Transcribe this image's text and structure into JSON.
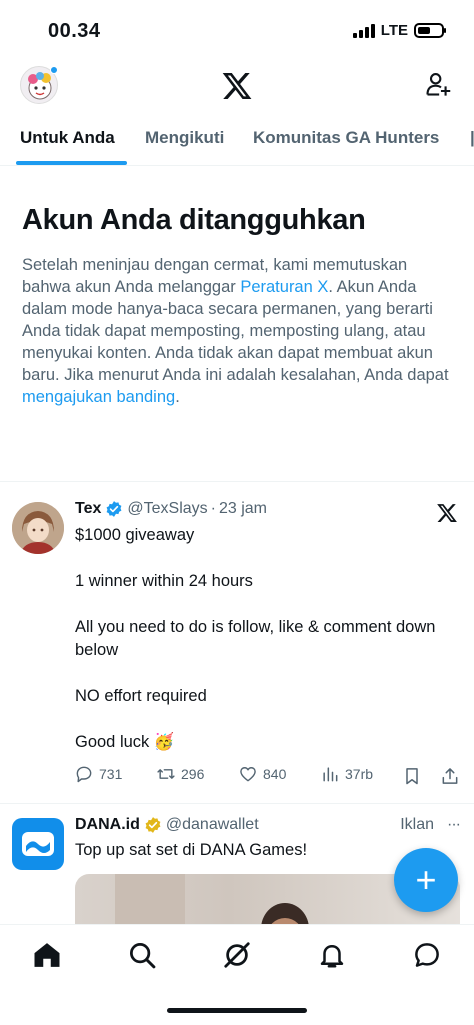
{
  "status_bar": {
    "time": "00.34",
    "network": "LTE",
    "battery_level": 0.55
  },
  "top_bar": {
    "logo_icon": "x-logo-icon",
    "profile_icon": "avatar",
    "follow_icon": "add-person-icon"
  },
  "tabs": [
    {
      "label": "Untuk Anda",
      "active": true
    },
    {
      "label": "Mengikuti",
      "active": false
    },
    {
      "label": "Komunitas GA Hunters",
      "active": false
    }
  ],
  "suspended": {
    "title": "Akun Anda ditangguhkan",
    "text_1": "Setelah meninjau dengan cermat, kami memutuskan bahwa akun Anda melanggar ",
    "link_rules": "Peraturan X",
    "text_2": ". Akun Anda dalam mode hanya-baca secara permanen, yang berarti Anda tidak dapat memposting, memposting ulang, atau menyukai konten. Anda tidak akan dapat membuat akun baru. Jika menurut Anda ini adalah kesalahan, Anda dapat ",
    "link_appeal": "mengajukan banding",
    "text_3": "."
  },
  "tweet": {
    "name": "Tex",
    "handle": "@TexSlays",
    "separator": "·",
    "time": "23 jam",
    "lines": [
      "$1000 giveaway",
      "1 winner within 24 hours",
      "All you need to do is follow, like & comment down below",
      "NO effort required",
      "Good luck 🥳"
    ],
    "replies": "731",
    "reposts": "296",
    "likes": "840",
    "views": "37rb"
  },
  "ad": {
    "name": "DANA.id",
    "handle": "@danawallet",
    "label": "Iklan",
    "more": "···",
    "text": "Top up sat set di DANA Games!"
  },
  "fab": {
    "label": "+"
  },
  "colors": {
    "accent": "#1d9bf0",
    "text_primary": "#0f1419",
    "text_secondary": "#536471",
    "verified_gold": "#e2b719"
  }
}
